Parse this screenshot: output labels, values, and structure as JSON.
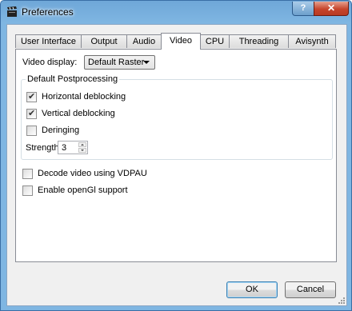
{
  "window": {
    "title": "Preferences",
    "help_label": "?",
    "close_label": "✕"
  },
  "tabs": [
    {
      "label": "User Interface"
    },
    {
      "label": "Output"
    },
    {
      "label": "Audio"
    },
    {
      "label": "Video",
      "active": true
    },
    {
      "label": "CPU"
    },
    {
      "label": "Threading"
    },
    {
      "label": "Avisynth"
    }
  ],
  "video": {
    "display_label": "Video display:",
    "display_value": "Default Raster",
    "postprocessing": {
      "group_title": "Default Postprocessing",
      "horizontal_deblocking": {
        "label": "Horizontal deblocking",
        "checked": true
      },
      "vertical_deblocking": {
        "label": "Vertical deblocking",
        "checked": true
      },
      "deringing": {
        "label": "Deringing",
        "checked": false
      },
      "strength_label": "Strength:",
      "strength_value": "3"
    },
    "vdpau": {
      "label": "Decode video using VDPAU",
      "checked": false
    },
    "opengl": {
      "label": "Enable openGl support",
      "checked": false
    }
  },
  "buttons": {
    "ok": "OK",
    "cancel": "Cancel"
  },
  "colors": {
    "titlebar": "#7fb6e2",
    "close": "#c6452c",
    "panel": "#ffffff",
    "dialog": "#f0f0f0"
  }
}
